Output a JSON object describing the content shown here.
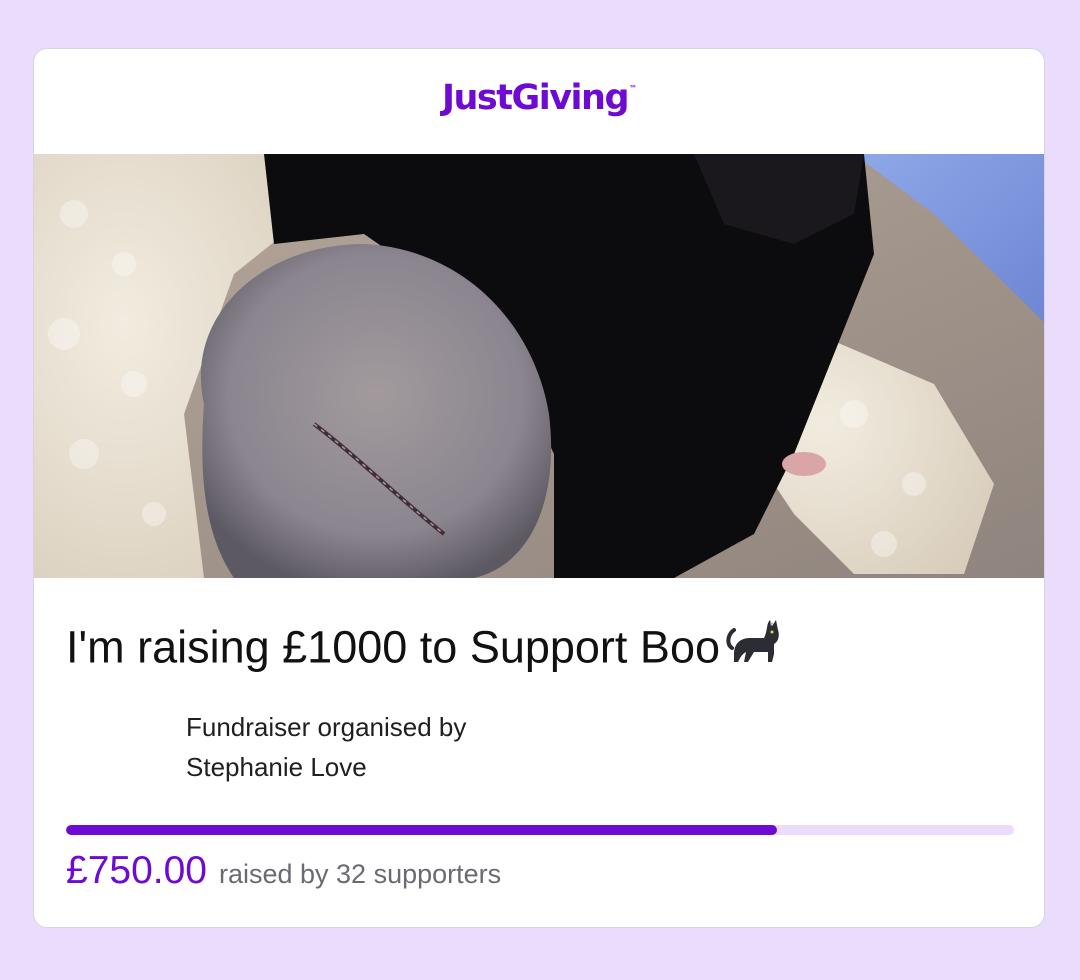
{
  "brand": {
    "logo_text": "JustGiving",
    "trademark": "™",
    "accent_color": "#6e0ad1"
  },
  "hero_image": {
    "description_icon": "cat-photo"
  },
  "fundraiser": {
    "title": "I'm raising £1000 to Support Boo",
    "title_emoji": "black-cat-icon",
    "organiser_label": "Fundraiser organised by",
    "organiser_name": "Stephanie Love"
  },
  "progress": {
    "fraction": 0.75,
    "amount_raised": "£750.00",
    "supporters_text": "raised by 32 supporters"
  }
}
